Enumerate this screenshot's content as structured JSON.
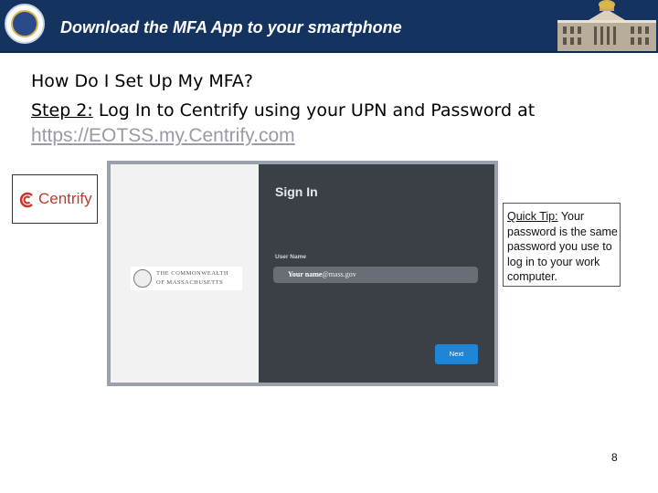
{
  "header": {
    "title": "Download the MFA App to your smartphone",
    "background_color": "#14345f"
  },
  "content": {
    "heading": "How Do I Set Up My MFA?",
    "step_label": "Step 2:",
    "step_text": " Log In to Centrify using your UPN and Password at",
    "url": "https://EOTSS.my.Centrify.com"
  },
  "centrify_logo": {
    "text": "Centrify",
    "icon": "centrify-c-logo-icon",
    "color": "#c0392b"
  },
  "signin_screenshot": {
    "logo_line1": "THE COMMONWEALTH",
    "logo_line2": "OF MASSACHUSETTS",
    "title": "Sign In",
    "username_label": "User Name",
    "username_value_name": "Your name",
    "username_value_domain": "@mass.gov",
    "next_button": "Next",
    "next_button_color": "#1f86d6"
  },
  "quick_tip": {
    "label": "Quick Tip:",
    "text": " Your password is the same password you use to log in to your work computer."
  },
  "page_number": "8"
}
